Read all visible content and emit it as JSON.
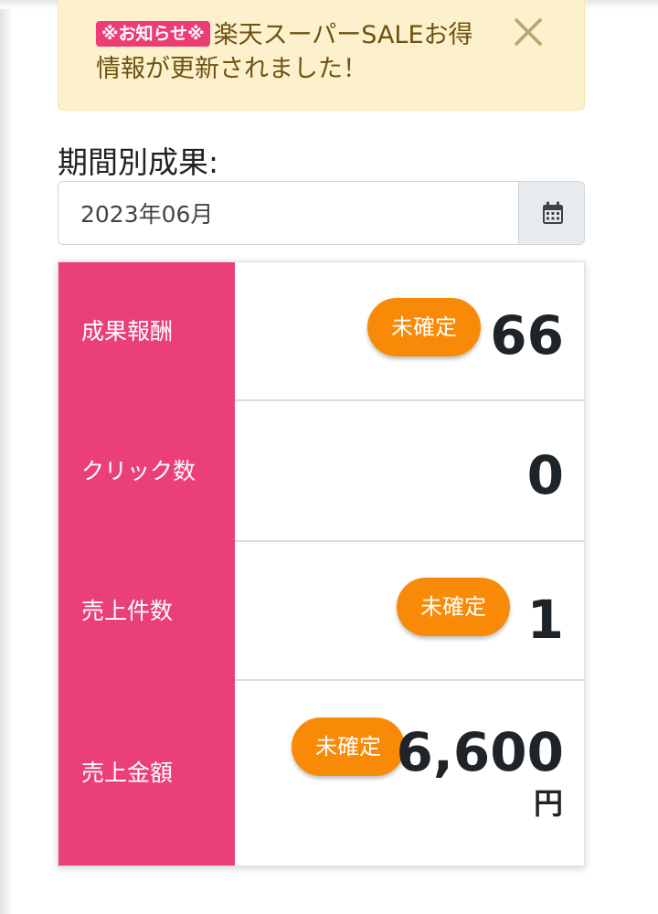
{
  "notice": {
    "badge": "※お知らせ※",
    "message": "楽天スーパーSALEお得情報が更新されました！",
    "close_icon": "close-icon"
  },
  "period": {
    "label": "期間別成果:",
    "value": "2023年06月",
    "calendar_icon": "calendar-icon"
  },
  "results": {
    "rows": [
      {
        "label": "成果報酬",
        "badge": "未確定",
        "value": "66"
      },
      {
        "label": "クリック数",
        "badge": "",
        "value": "0"
      },
      {
        "label": "売上件数",
        "badge": "未確定",
        "value": "1"
      },
      {
        "label": "売上金額",
        "badge": "未確定",
        "value": "6,600",
        "unit": "円"
      }
    ]
  },
  "colors": {
    "accent_pink": "#ea3f79",
    "badge_orange": "#f98a08",
    "notice_background": "#fcf1cc",
    "notice_text": "#6e5210"
  }
}
